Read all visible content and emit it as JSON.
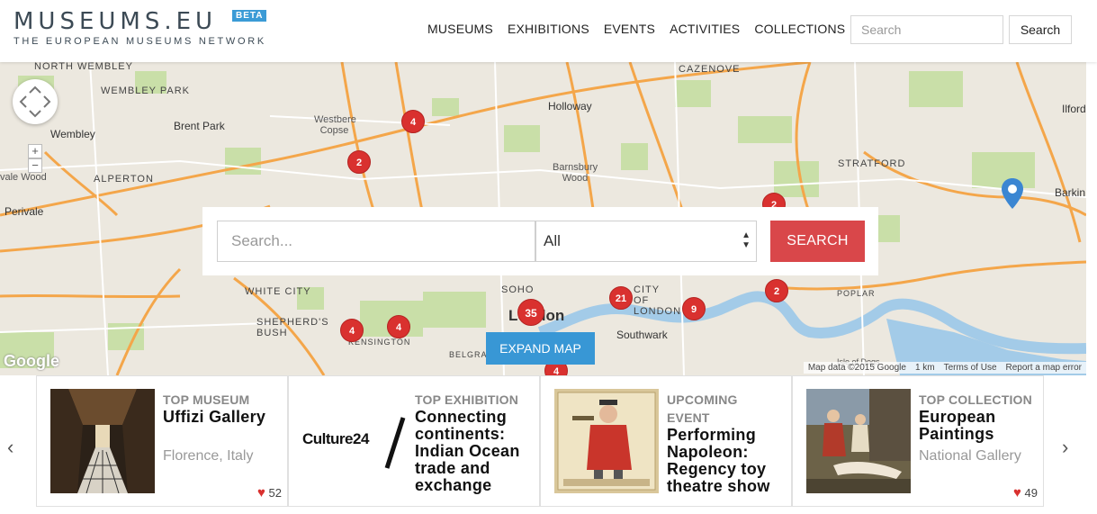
{
  "header": {
    "logo": "MUSEUMS.EU",
    "beta": "BETA",
    "tagline": "THE EUROPEAN MUSEUMS NETWORK",
    "nav": [
      "MUSEUMS",
      "EXHIBITIONS",
      "EVENTS",
      "ACTIVITIES",
      "COLLECTIONS"
    ],
    "search_placeholder": "Search",
    "search_button": "Search"
  },
  "map": {
    "labels": {
      "north_wembley": "NORTH WEMBLEY",
      "wembley_park": "WEMBLEY PARK",
      "wembley": "Wembley",
      "brent_park": "Brent Park",
      "westbere_copse": "Westbere Copse",
      "holloway": "Holloway",
      "cazenove": "CAZENOVE",
      "barnsbury_wood": "Barnsbury Wood",
      "stratford": "STRATFORD",
      "ilford": "Ilford",
      "barking": "Barkin",
      "alperton": "ALPERTON",
      "vale_wood": "vale Wood",
      "perivale": "Perivale",
      "white_city": "WHITE CITY",
      "shepherds_bush": "SHEPHERD'S BUSH",
      "kensington": "KENSINGTON",
      "soho": "SOHO",
      "london": "London",
      "city_of_london": "CITY OF LONDON",
      "southwark": "Southwark",
      "poplar": "POPLAR",
      "isle_of_dogs": "Isle of Dogs",
      "belgravia": "BELGRAVI"
    },
    "markers": [
      "4",
      "2",
      "4",
      "4",
      "35",
      "21",
      "9",
      "2",
      "2",
      "4"
    ],
    "zoom_in": "+",
    "zoom_out": "−",
    "google": "Google",
    "attribution": {
      "data": "Map data ©2015 Google",
      "scale": "1 km",
      "terms": "Terms of Use",
      "report": "Report a map error"
    },
    "search": {
      "placeholder": "Search...",
      "select_value": "All",
      "button": "SEARCH"
    },
    "expand_button": "EXPAND MAP",
    "colors": {
      "water": "#a3cbe8",
      "park": "#c9dfa8",
      "road": "#f4a64a",
      "marker": "#d9312f"
    }
  },
  "cards": [
    {
      "category": "TOP MUSEUM",
      "title": "Uffizi Gallery",
      "subtitle": "Florence, Italy",
      "likes": "52"
    },
    {
      "category": "TOP EXHIBITION",
      "title": "Connecting continents: Indian Ocean trade and exchange",
      "logo": "Culture24"
    },
    {
      "category": "UPCOMING EVENT",
      "title": "Performing Napoleon: Regency toy theatre show"
    },
    {
      "category": "TOP COLLECTION",
      "title": "European Paintings",
      "subtitle": "National Gallery",
      "likes": "49"
    }
  ],
  "carousel": {
    "prev": "‹",
    "next": "›"
  }
}
